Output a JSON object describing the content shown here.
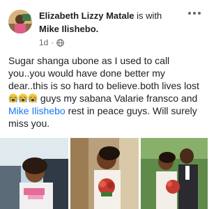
{
  "post": {
    "author": "Elizabeth Lizzy Matale",
    "with_text": "is with",
    "tagged_user": "Mike Ilishebo",
    "tagged_suffix": ".",
    "timestamp": "1d",
    "separator": "·",
    "privacy_icon": "globe-icon",
    "more_icon": "more-options-icon",
    "text_part1": "Sugar shanga ubone as I used to call you..you would have done better my dear..this is so hard to believe.both lives lost",
    "emoji_name": "loudly-crying-face",
    "emoji_count": 3,
    "text_part2": " guys my sabana Valarie fransco and ",
    "mention": "Mike Ilishebo",
    "text_part3": " rest in peace guys. Will surely miss you."
  },
  "photos": [
    {
      "name": "photo-woman-smiling"
    },
    {
      "name": "photo-bride-with-bouquet"
    },
    {
      "name": "photo-wedding-couple"
    }
  ],
  "colors": {
    "link": "#1877f2",
    "text": "#1c1e21",
    "meta": "#65676b"
  }
}
